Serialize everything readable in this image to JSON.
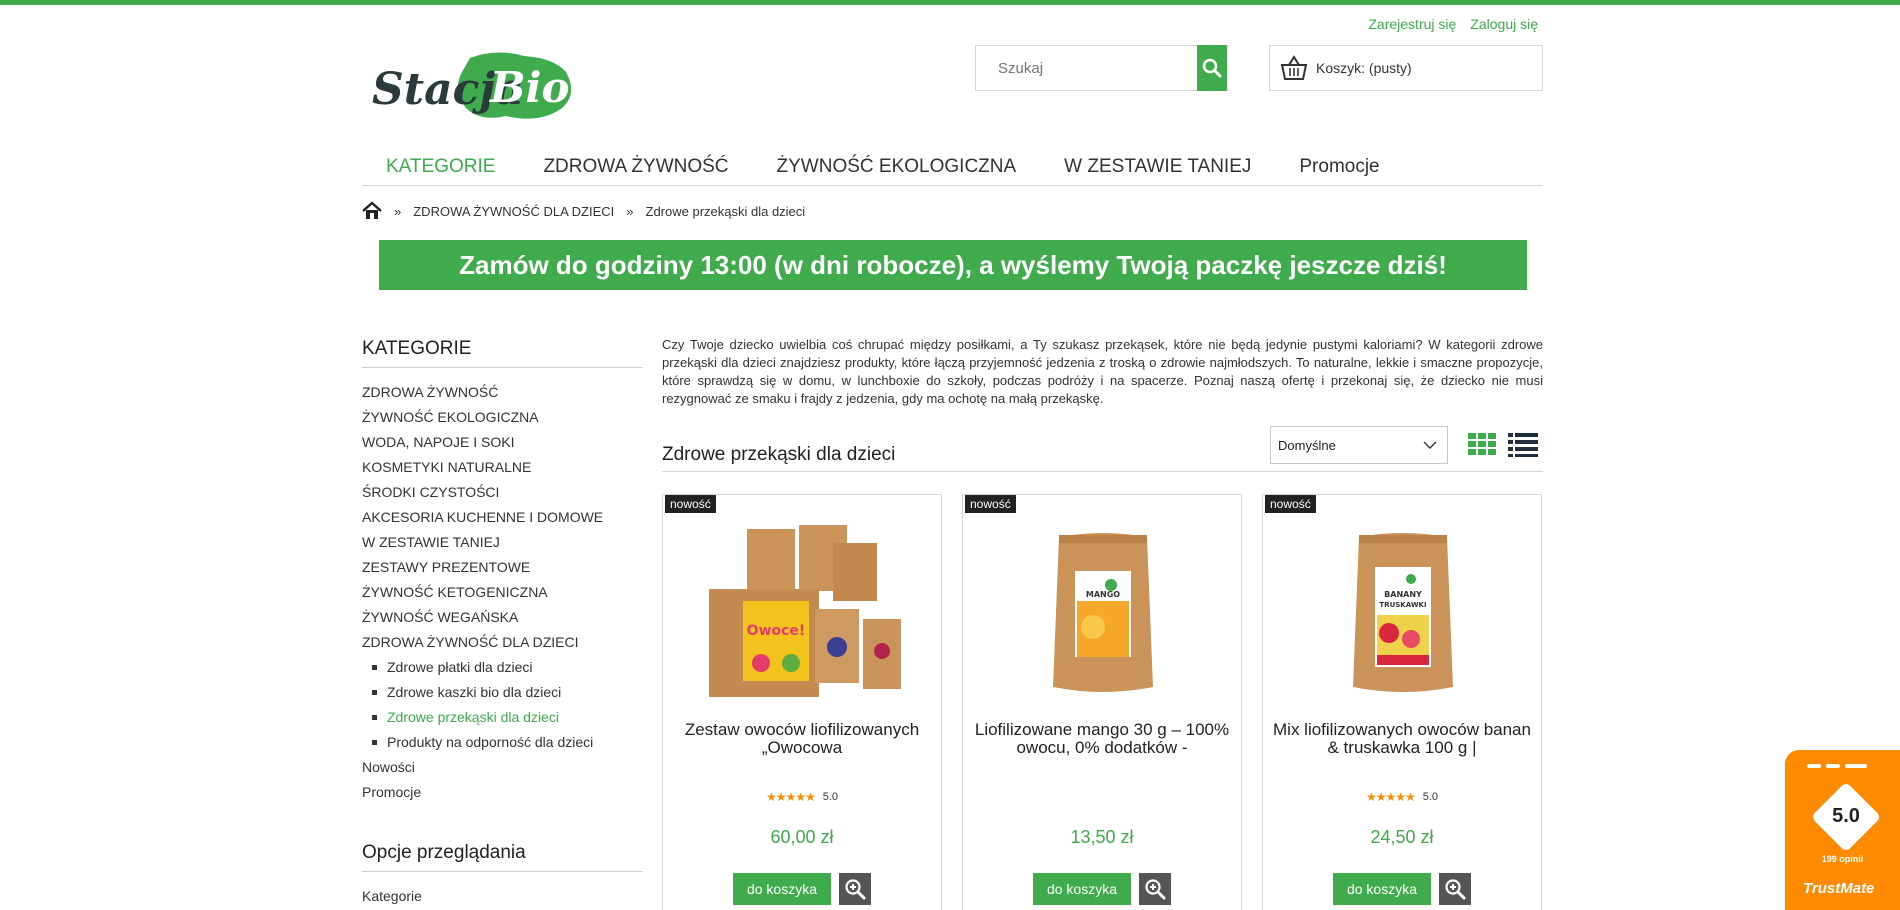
{
  "header": {
    "register": "Zarejestruj się",
    "login": "Zaloguj się",
    "logo_text": "Stacja Bio",
    "search_placeholder": "Szukaj",
    "cart_label": "Koszyk: (pusty)"
  },
  "nav": {
    "items": [
      "KATEGORIE",
      "ZDROWA ŻYWNOŚĆ",
      "ŻYWNOŚĆ EKOLOGICZNA",
      "W ZESTAWIE TANIEJ",
      "Promocje"
    ]
  },
  "breadcrumb": {
    "sep": "»",
    "items": [
      "ZDROWA ŻYWNOŚĆ DLA DZIECI",
      "Zdrowe przekąski dla dzieci"
    ]
  },
  "banner": "Zamów do godziny 13:00 (w dni robocze), a wyślemy Twoją paczkę jeszcze dziś!",
  "sidebar": {
    "title": "KATEGORIE",
    "categories": [
      "ZDROWA ŻYWNOŚĆ",
      "ŻYWNOŚĆ EKOLOGICZNA",
      "WODA, NAPOJE I SOKI",
      "KOSMETYKI NATURALNE",
      "ŚRODKI CZYSTOŚCI",
      "AKCESORIA KUCHENNE I DOMOWE",
      "W ZESTAWIE TANIEJ",
      "ZESTAWY PREZENTOWE",
      "ŻYWNOŚĆ KETOGENICZNA",
      "ŻYWNOŚĆ WEGAŃSKA",
      "ZDROWA ŻYWNOŚĆ DLA DZIECI"
    ],
    "subcategories": [
      "Zdrowe płatki dla dzieci",
      "Zdrowe kaszki bio dla dzieci",
      "Zdrowe przekąski dla dzieci",
      "Produkty na odporność dla dzieci"
    ],
    "active_sub": "Zdrowe przekąski dla dzieci",
    "extra": [
      "Nowości",
      "Promocje"
    ],
    "options_title": "Opcje przeglądania",
    "options_first": "Kategorie"
  },
  "main": {
    "description": "Czy Twoje dziecko uwielbia coś chrupać między posiłkami, a Ty szukasz przekąsek, które nie będą jedynie pustymi kaloriami? W kategorii zdrowe przekąski dla dzieci znajdziesz produkty, które łączą przyjemność jedzenia z troską o zdrowie najmłodszych. To naturalne, lekkie i smaczne propozycje, które sprawdzą się w domu, w lunchboxie do szkoły, podczas podróży i na spacerze. Poznaj naszą ofertę i przekonaj się, że dziecko nie musi rezygnować ze smaku i frajdy z jedzenia, gdy ma ochotę na małą przekąskę.",
    "list_title": "Zdrowe przekąski dla dzieci",
    "sort_value": "Domyślne"
  },
  "products": [
    {
      "badge": "nowość",
      "name": "Zestaw owoców liofilizowanych „Owocowa",
      "rating": "5.0",
      "price": "60,00 zł",
      "cart_button": "do koszyka"
    },
    {
      "badge": "nowość",
      "name": "Liofilizowane mango 30 g – 100% owocu, 0% dodatków -",
      "rating": "",
      "price": "13,50 zł",
      "cart_button": "do koszyka"
    },
    {
      "badge": "nowość",
      "name": "Mix liofilizowanych owoców banan & truskawka 100 g |",
      "rating": "5.0",
      "price": "24,50 zł",
      "cart_button": "do koszyka"
    }
  ],
  "trustmate": {
    "score": "5.0",
    "reviews": "199 opinii",
    "brand": "TrustMate"
  },
  "colors": {
    "accent": "#3fab4c",
    "star": "#ff8a00",
    "badge_bg": "#222222"
  }
}
